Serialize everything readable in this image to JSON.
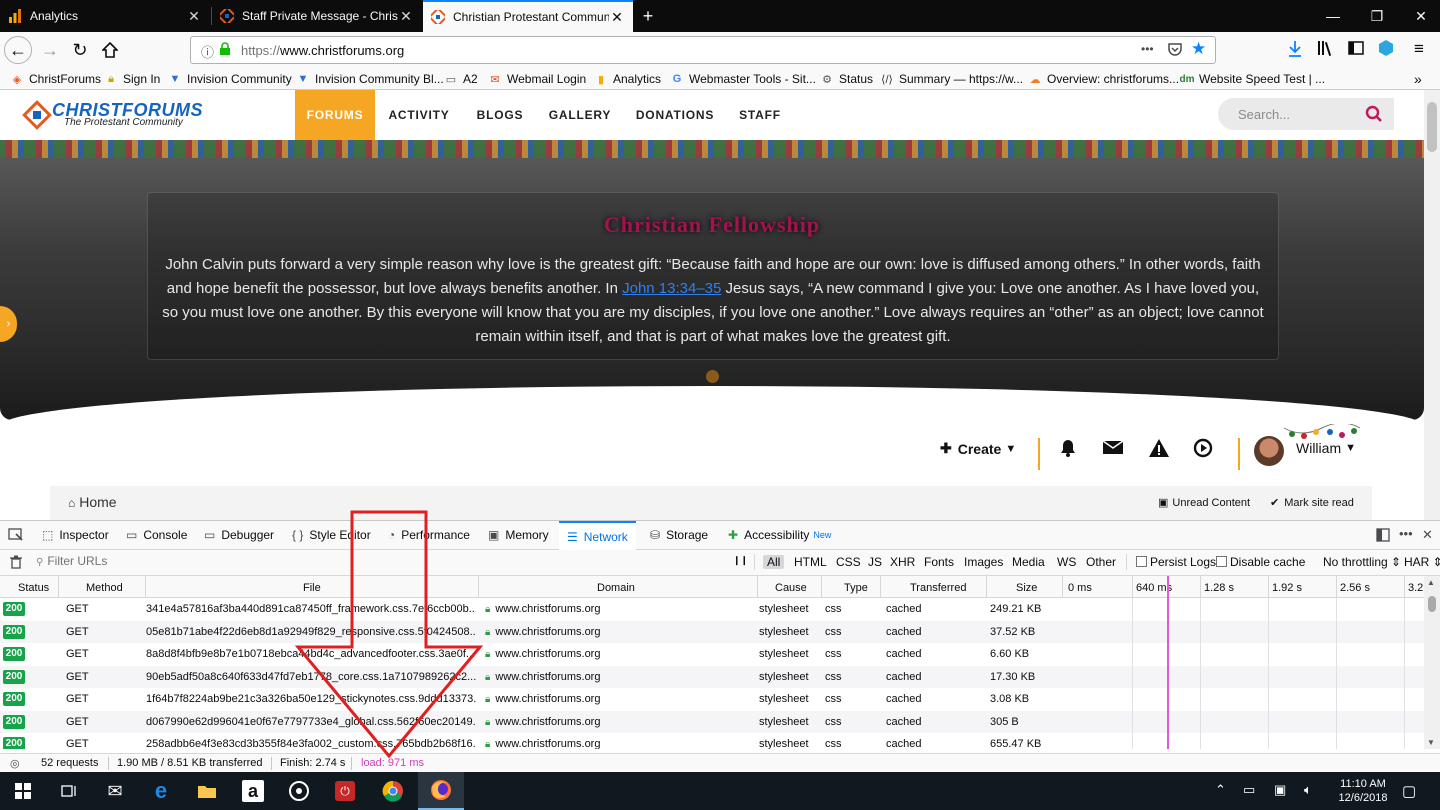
{
  "browser": {
    "tabs": [
      {
        "title": "Analytics",
        "close": "✕"
      },
      {
        "title": "Staff Private Message - ChristFo",
        "close": "✕"
      },
      {
        "title": "Christian Protestant Community",
        "close": "✕"
      }
    ],
    "new_tab": "+",
    "window_controls": {
      "minimize": "—",
      "restore": "❐",
      "close": "✕"
    },
    "url_protocol": "https://",
    "url_host": "www.christforums.org",
    "page_actions": "•••"
  },
  "bookmarks": [
    {
      "label": "ChristForums",
      "icon": "christforums-icon"
    },
    {
      "label": "Sign In",
      "icon": "lock-icon"
    },
    {
      "label": "Invision Community",
      "icon": "invision-icon"
    },
    {
      "label": "Invision Community Bl...",
      "icon": "invision-icon"
    },
    {
      "label": "A2",
      "icon": "folder-icon"
    },
    {
      "label": "Webmail Login",
      "icon": "webmail-icon"
    },
    {
      "label": "Analytics",
      "icon": "analytics-icon"
    },
    {
      "label": "Webmaster Tools - Sit...",
      "icon": "google-icon"
    },
    {
      "label": "Status",
      "icon": "status-icon"
    },
    {
      "label": "Summary — https://w...",
      "icon": "summary-icon"
    },
    {
      "label": "Overview: christforums...",
      "icon": "cloudflare-icon"
    },
    {
      "label": "Website Speed Test | ...",
      "icon": "dm-icon"
    }
  ],
  "site": {
    "logo_main": "CHRISTFORUMS",
    "logo_sub": "The Protestant Community",
    "nav": [
      "FORUMS",
      "ACTIVITY",
      "BLOGS",
      "GALLERY",
      "DONATIONS",
      "STAFF"
    ],
    "search_placeholder": "Search...",
    "hero_title": "Christian Fellowship",
    "hero_quote_before": "John Calvin puts forward a very simple reason why love is the greatest gift: “Because faith and hope are our own: love is diffused among others.” In other words, faith and hope benefit the possessor, but love always benefits another. In ",
    "hero_quote_link": "John 13:34–35",
    "hero_quote_after": " Jesus says, “A new command I give you: Love one another. As I have loved you, so you must love one another. By this everyone will know that you are my disciples, if you love one another.” Love always requires an “other” as an object; love cannot remain within itself, and that is part of what makes love the greatest gift.",
    "create_label": "Create",
    "username": "William",
    "breadcrumb_home": "Home",
    "unread_content": "Unread Content",
    "mark_site_read": "Mark site read"
  },
  "devtools": {
    "tabs": [
      "Inspector",
      "Console",
      "Debugger",
      "Style Editor",
      "Performance",
      "Memory",
      "Network",
      "Storage",
      "Accessibility"
    ],
    "new_badge": "New",
    "filter_placeholder": "Filter URLs",
    "pause": "❙❙",
    "type_filters": [
      "All",
      "HTML",
      "CSS",
      "JS",
      "XHR",
      "Fonts",
      "Images",
      "Media",
      "WS",
      "Other"
    ],
    "persist_logs": "Persist Logs",
    "disable_cache": "Disable cache",
    "throttling": "No throttling ⇕",
    "har": "HAR ⇕",
    "columns": [
      "Status",
      "Method",
      "File",
      "Domain",
      "Cause",
      "Type",
      "Transferred",
      "Size"
    ],
    "timeline_ticks": [
      "0 ms",
      "640 ms",
      "1.28 s",
      "1.92 s",
      "2.56 s",
      "3.2"
    ],
    "rows": [
      {
        "status": "200",
        "method": "GET",
        "file": "341e4a57816af3ba440d891ca87450ff_framework.css.7ef6ccb00b...",
        "domain": "www.christforums.org",
        "cause": "stylesheet",
        "type": "css",
        "transferred": "cached",
        "size": "249.21 KB"
      },
      {
        "status": "200",
        "method": "GET",
        "file": "05e81b71abe4f22d6eb8d1a92949f829_responsive.css.5f0424508...",
        "domain": "www.christforums.org",
        "cause": "stylesheet",
        "type": "css",
        "transferred": "cached",
        "size": "37.52 KB"
      },
      {
        "status": "200",
        "method": "GET",
        "file": "8a8d8f4bfb9e8b7e1b0718ebca44bd4c_advancedfooter.css.3ae0f...",
        "domain": "www.christforums.org",
        "cause": "stylesheet",
        "type": "css",
        "transferred": "cached",
        "size": "6.60 KB"
      },
      {
        "status": "200",
        "method": "GET",
        "file": "90eb5adf50a8c640f633d47fd7eb1778_core.css.1a7107989262c2...",
        "domain": "www.christforums.org",
        "cause": "stylesheet",
        "type": "css",
        "transferred": "cached",
        "size": "17.30 KB"
      },
      {
        "status": "200",
        "method": "GET",
        "file": "1f64b7f8224ab9be21c3a326ba50e129_stickynotes.css.9ddd13373...",
        "domain": "www.christforums.org",
        "cause": "stylesheet",
        "type": "css",
        "transferred": "cached",
        "size": "3.08 KB"
      },
      {
        "status": "200",
        "method": "GET",
        "file": "d067990e62d996041e0f67e7797733e4_global.css.562f60ec20149...",
        "domain": "www.christforums.org",
        "cause": "stylesheet",
        "type": "css",
        "transferred": "cached",
        "size": "305 B"
      },
      {
        "status": "200",
        "method": "GET",
        "file": "258adbb6e4f3e83cd3b355f84e3fa002_custom.css.765bdb2b68f16...",
        "domain": "www.christforums.org",
        "cause": "stylesheet",
        "type": "css",
        "transferred": "cached",
        "size": "655.47 KB"
      }
    ],
    "summary": {
      "requests": "52 requests",
      "transferred": "1.90 MB / 8.51 KB transferred",
      "finish": "Finish: 2.74 s",
      "load": "load: 971 ms"
    }
  },
  "taskbar": {
    "time": "11:10 AM",
    "date": "12/6/2018"
  },
  "colors": {
    "accent": "#f5a623",
    "devtools_selected": "#0074e8",
    "status_ok": "#16a34a",
    "load_text": "#d63bbd",
    "annotation_arrow": "#e02020"
  }
}
